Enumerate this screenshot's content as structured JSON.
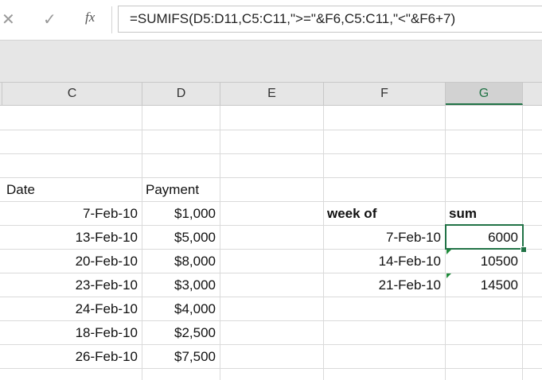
{
  "formula_bar": {
    "cancel_icon": "✕",
    "enter_icon": "✓",
    "fx_label": "fx",
    "formula": "=SUMIFS(D5:D11,C5:C11,\">=\"&F6,C5:C11,\"<\"&F6+7)"
  },
  "columns": [
    "C",
    "D",
    "E",
    "F",
    "G"
  ],
  "selected_column": "G",
  "table": {
    "headers": [
      "Date",
      "Payment"
    ],
    "rows": [
      [
        "7-Feb-10",
        "$1,000"
      ],
      [
        "13-Feb-10",
        "$5,000"
      ],
      [
        "20-Feb-10",
        "$8,000"
      ],
      [
        "23-Feb-10",
        "$3,000"
      ],
      [
        "24-Feb-10",
        "$4,000"
      ],
      [
        "18-Feb-10",
        "$2,500"
      ],
      [
        "26-Feb-10",
        "$7,500"
      ]
    ]
  },
  "summary": {
    "headers": [
      "week of",
      "sum"
    ],
    "rows": [
      [
        "7-Feb-10",
        "6000"
      ],
      [
        "14-Feb-10",
        "10500"
      ],
      [
        "21-Feb-10",
        "14500"
      ]
    ]
  },
  "colors": {
    "accent": "#217346"
  }
}
